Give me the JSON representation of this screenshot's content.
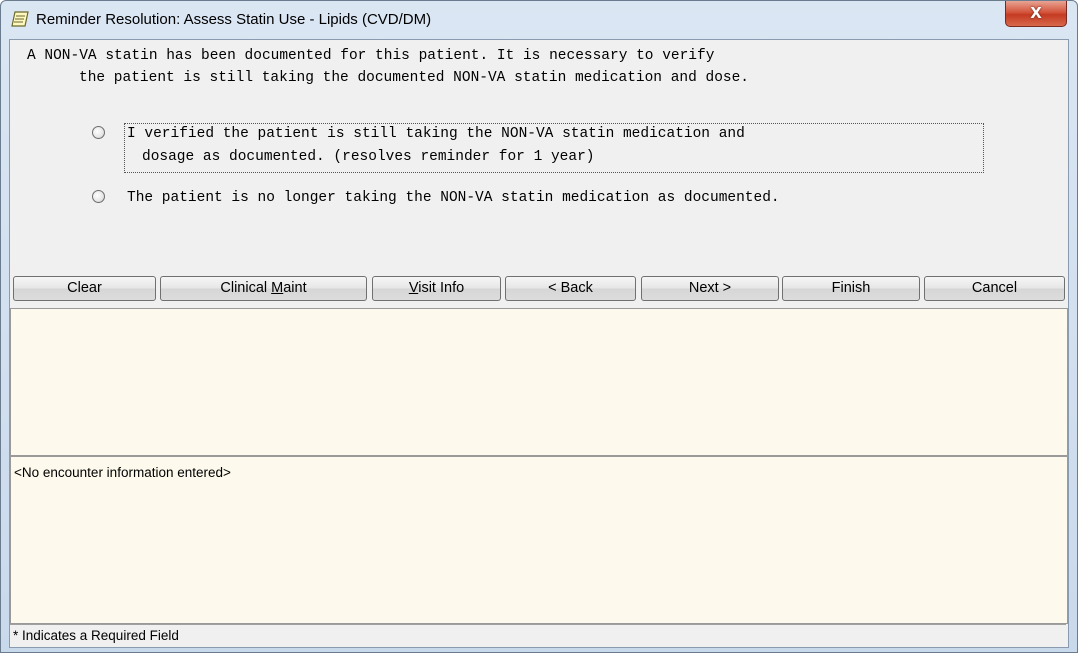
{
  "window": {
    "title": "Reminder Resolution: Assess Statin Use - Lipids (CVD/DM)",
    "close_label": "X"
  },
  "prompt": {
    "line1": "A NON-VA statin has been documented for this patient. It is necessary to verify",
    "line2": "the patient is still taking the documented NON-VA statin medication and dose."
  },
  "options": [
    {
      "line1": "I verified the patient is still taking the NON-VA statin medication and",
      "line2": "dosage as documented. (resolves reminder for 1 year)",
      "selected": false
    },
    {
      "line1": "The patient is no longer taking the NON-VA statin medication as documented.",
      "selected": false
    }
  ],
  "buttons": {
    "clear": "Clear",
    "clinical_maint_pre": "Clinical ",
    "clinical_maint_mn": "M",
    "clinical_maint_post": "aint",
    "visit_info_mn": "V",
    "visit_info_post": "isit Info",
    "back": "< Back",
    "next": "Next >",
    "finish": "Finish",
    "cancel": "Cancel"
  },
  "encounter": {
    "text": "<No encounter information entered>"
  },
  "status": {
    "text": "* Indicates a Required Field"
  }
}
